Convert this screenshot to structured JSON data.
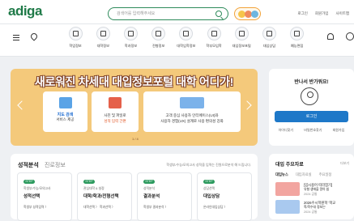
{
  "header": {
    "logo": "adiga",
    "search_placeholder": "검색어를 입력해주세요",
    "links": [
      "로그인",
      "회원가입",
      "사이트맵"
    ]
  },
  "nav": {
    "items": [
      {
        "label": "학업정보",
        "icon": "id-card-icon"
      },
      {
        "label": "대학정보",
        "icon": "building-icon"
      },
      {
        "label": "학과정보",
        "icon": "document-icon"
      },
      {
        "label": "전형정보",
        "icon": "clipboard-icon"
      },
      {
        "label": "대학입학정보",
        "icon": "graduation-cap-icon"
      },
      {
        "label": "학부모입학",
        "icon": "book-icon"
      },
      {
        "label": "대입정보포털",
        "icon": "target-icon"
      },
      {
        "label": "대입상담",
        "icon": "chat-icon"
      },
      {
        "label": "예능면접",
        "icon": "palette-icon"
      }
    ]
  },
  "banner": {
    "title": "새로워진 차세대 대입정보포털 대학 어디가!",
    "cards": [
      {
        "line1": "지도 검색",
        "line2": "서비스 제공"
      },
      {
        "line1": "사진 및 파일로",
        "line2": "성적 입력 간편"
      },
      {
        "line1": "고객 중심 사용자 인터페이스(UI)와",
        "line2": "사용자 경험(UX) 설계로 사용 편의성 강화"
      }
    ],
    "pager": "1 / 4"
  },
  "login": {
    "greeting": "반나서 반가워요!",
    "button": "로그인",
    "links": [
      "아이디찾기",
      "비밀번호찾기",
      "회원가입"
    ]
  },
  "analysis": {
    "tab_active": "성적분석",
    "tab_inactive": "진로정보",
    "note": "학생부/수능/모의고사 성적을 입력는 진원으로분석 해 드립니다.",
    "cards": [
      {
        "badge": "STEP",
        "sub": "학생부/수능/모의고사",
        "main": "성적선택",
        "bottom": "학생부 성적입력 〉"
      },
      {
        "badge": "STEP",
        "sub": "관심대학 & 설정",
        "main": "대학/학과/전형선택",
        "bottom": "대학선택 〉  학과선택 〉"
      },
      {
        "badge": "STEP",
        "sub": "성적분석",
        "main": "결과분석",
        "bottom": "학생부 결과분석 〉"
      },
      {
        "badge": "STEP",
        "sub": "상담선택",
        "main": "대입상담",
        "bottom": "온라인대입상담 〉"
      }
    ]
  },
  "news": {
    "title": "대입 주요자료",
    "more": "더보기",
    "tabs": [
      "대입뉴스",
      "대입자료실",
      "주요일정"
    ],
    "items": [
      {
        "title": "[입시용어 따라잡기]",
        "subtitle": "유형 생애을 알아 쉽",
        "date": "2024 공통"
      },
      {
        "title": "2026수시학원학 '학교",
        "subtitle": "학/학수대 정보는'",
        "date": "2024 공통"
      }
    ]
  }
}
